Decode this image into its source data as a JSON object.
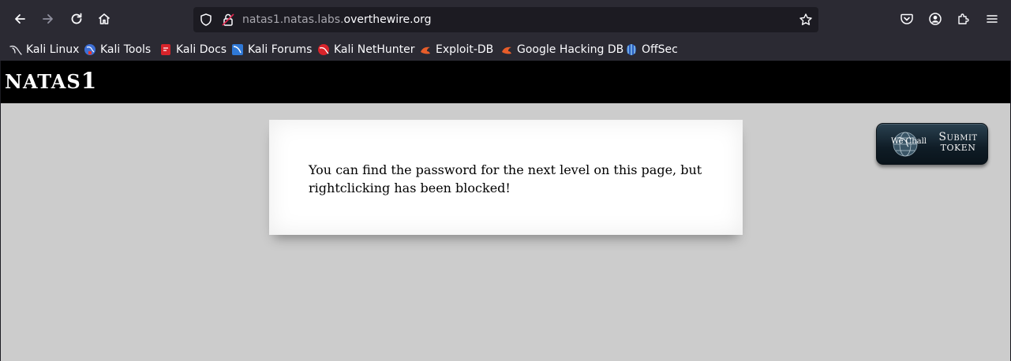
{
  "browser": {
    "url_subdomain": "natas1.natas.labs.",
    "url_domain": "overthewire.org"
  },
  "bookmarks": [
    {
      "label": "Kali Linux",
      "icon": "kali-dragon-icon"
    },
    {
      "label": "Kali Tools",
      "icon": "kali-tools-icon"
    },
    {
      "label": "Kali Docs",
      "icon": "kali-docs-icon"
    },
    {
      "label": "Kali Forums",
      "icon": "kali-forums-icon"
    },
    {
      "label": "Kali NetHunter",
      "icon": "kali-nethunter-icon"
    },
    {
      "label": "Exploit-DB",
      "icon": "exploit-db-icon"
    },
    {
      "label": "Google Hacking DB",
      "icon": "ghdb-icon"
    },
    {
      "label": "OffSec",
      "icon": "offsec-icon"
    }
  ],
  "site": {
    "title_prefix": "natas",
    "title_number": "1",
    "message": "You can find the password for the next level on this page, but rightclicking has been blocked!",
    "token_button": {
      "line1": "Submit",
      "line2": "Token",
      "logo_text": "We Chall"
    }
  },
  "colors": {
    "page_background": "#cccccc",
    "header_background": "#000000",
    "browser_chrome": "#2b2a33"
  }
}
